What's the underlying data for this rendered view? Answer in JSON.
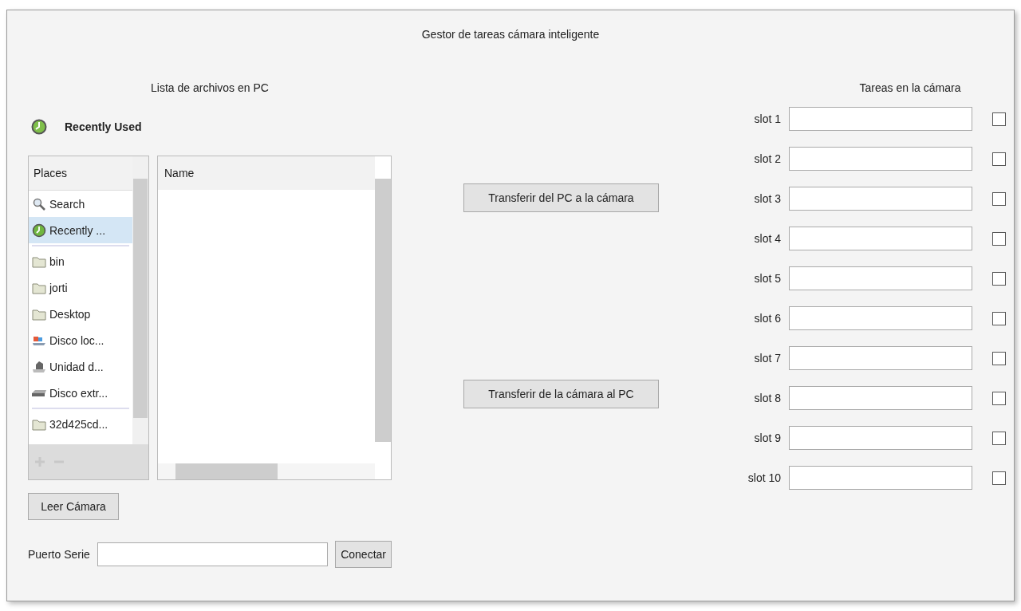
{
  "window": {
    "title": "Gestor de tareas cámara inteligente"
  },
  "file_panel": {
    "heading": "Lista de archivos en PC",
    "location": "Recently Used",
    "places_header": "Places",
    "place_sections": [
      [
        {
          "label": "Search",
          "kind": "search",
          "selected": false
        },
        {
          "label": "Recently ...",
          "kind": "recent",
          "selected": true
        }
      ],
      [
        {
          "label": "bin",
          "kind": "folder",
          "selected": false
        },
        {
          "label": "jorti",
          "kind": "folder",
          "selected": false
        },
        {
          "label": "Desktop",
          "kind": "folder",
          "selected": false
        },
        {
          "label": "Disco loc...",
          "kind": "disk",
          "selected": false
        },
        {
          "label": "Unidad d...",
          "kind": "drive",
          "selected": false
        },
        {
          "label": "Disco extr...",
          "kind": "external",
          "selected": false
        }
      ],
      [
        {
          "label": "32d425cd...",
          "kind": "folder",
          "selected": false
        }
      ]
    ],
    "files_header": "Name"
  },
  "transfer_buttons": [
    "Transferir del PC a la cámara",
    "Transferir de la cámara al PC"
  ],
  "camera_panel": {
    "heading": "Tareas en la cámara",
    "slots": [
      {
        "label": "slot 1",
        "checked": false
      },
      {
        "label": "slot 2",
        "checked": false
      },
      {
        "label": "slot 3",
        "checked": false
      },
      {
        "label": "slot 4",
        "checked": false
      },
      {
        "label": "slot 5",
        "checked": false
      },
      {
        "label": "slot 6",
        "checked": false
      },
      {
        "label": "slot 7",
        "checked": false
      },
      {
        "label": "slot 8",
        "checked": false
      },
      {
        "label": "slot 9",
        "checked": false
      },
      {
        "label": "slot 10",
        "checked": false
      }
    ]
  },
  "read_button": "Leer Cámara",
  "serial": {
    "label": "Puerto Serie",
    "button": "Conectar"
  }
}
